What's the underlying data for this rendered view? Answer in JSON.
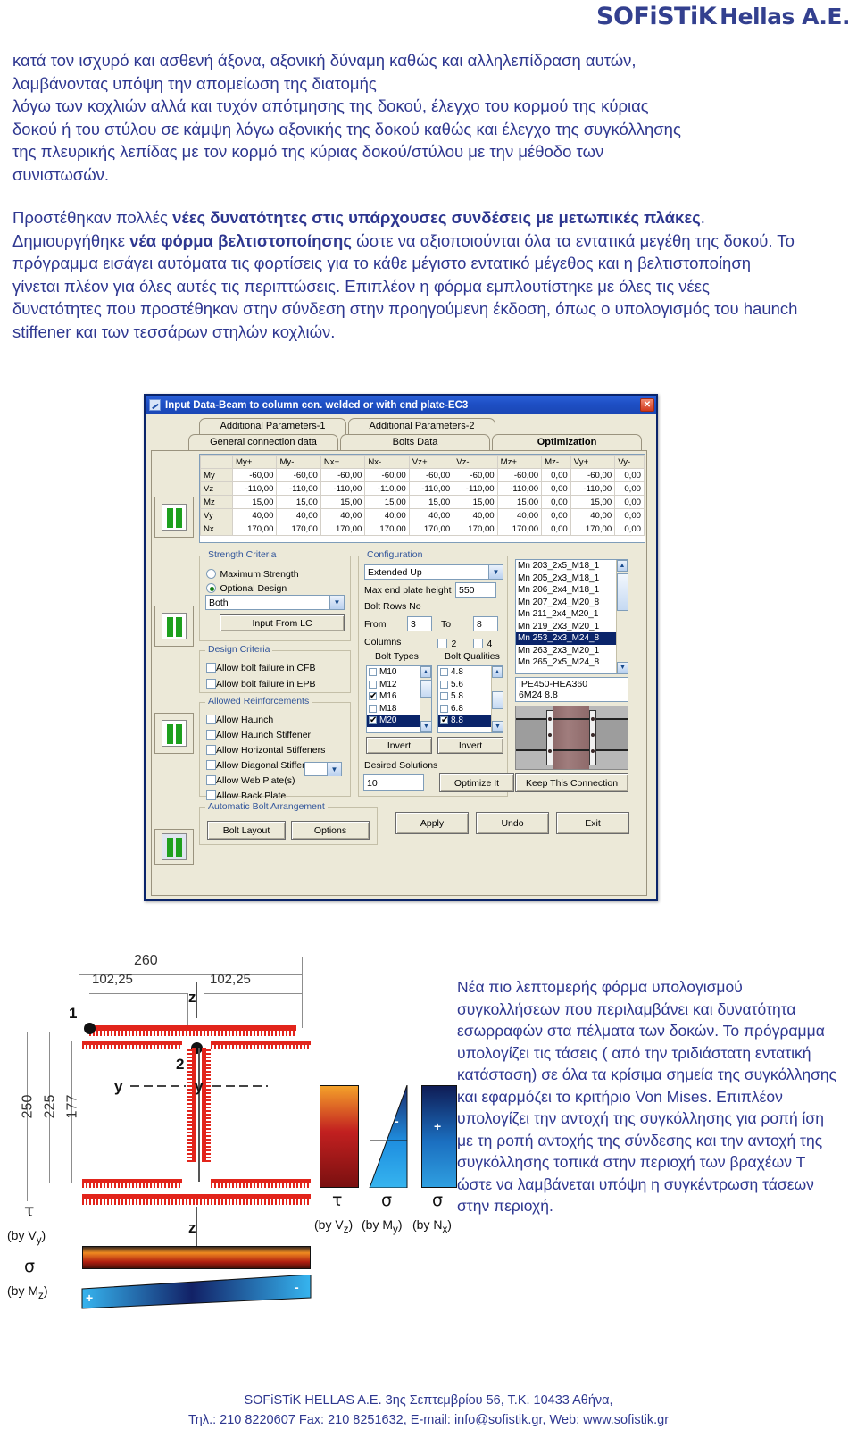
{
  "header": {
    "logo_main": "SOFiSTiK",
    "logo_sub": "Hellas A.E."
  },
  "paragraphs": {
    "p1_line1": "κατά τον ισχυρό και ασθενή άξονα, αξονική δύναμη καθώς και αλληλεπίδραση αυτών,",
    "p1_line2": "λαμβάνοντας υπόψη την απομείωση της διατομής",
    "p1_line3": "λόγω των κοχλιών αλλά και τυχόν απότμησης της δοκού, έλεγχο του κορμού της κύριας",
    "p1_line4": "δοκού ή του στύλου σε κάμψη λόγω αξονικής της δοκού καθώς και έλεγχο της συγκόλλησης",
    "p1_line5": "της πλευρικής λεπίδας με τον κορμό της κύριας δοκού/στύλου με την μέθοδο των",
    "p1_line6": "συνιστωσών.",
    "p2_a": "Προστέθηκαν πολλές ",
    "p2_b1": "νέες δυνατότητες στις υπάρχουσες συνδέσεις με μετωπικές πλάκες",
    "p2_c": ". Δημιουργήθηκε ",
    "p2_b2": "νέα φόρμα βελτιστοποίησης",
    "p2_d": " ώστε να αξιοποιούνται όλα τα εντατικά μεγέθη της δοκού. Το πρόγραμμα εισάγει αυτόματα τις φορτίσεις για το κάθε μέγιστο εντατικό μέγεθος και η βελτιστοποίηση γίνεται πλέον για όλες αυτές τις περιπτώσεις. Επιπλέον η φόρμα εμπλουτίστηκε με όλες τις νέες δυνατότητες που προστέθηκαν στην σύνδεση στην προηγούμενη έκδοση, όπως ο υπολογισμός του haunch stiffener και των τεσσάρων στηλών κοχλιών."
  },
  "dialog": {
    "title": "Input Data-Beam to column con. welded or with end plate-EC3",
    "close_label": "✕",
    "tabs_row1": [
      "Additional Parameters-1",
      "Additional Parameters-2"
    ],
    "tabs_row2": [
      "General connection data",
      "Bolts Data",
      "Optimization"
    ],
    "selected_tab": "Optimization",
    "grid": {
      "columns": [
        "My+",
        "My-",
        "Nx+",
        "Nx-",
        "Vz+",
        "Vz-",
        "Mz+",
        "Mz-",
        "Vy+",
        "Vy-"
      ],
      "rows": [
        {
          "label": "My",
          "values": [
            "-60,00",
            "-60,00",
            "-60,00",
            "-60,00",
            "-60,00",
            "-60,00",
            "-60,00",
            "0,00",
            "-60,00",
            "0,00"
          ]
        },
        {
          "label": "Vz",
          "values": [
            "-110,00",
            "-110,00",
            "-110,00",
            "-110,00",
            "-110,00",
            "-110,00",
            "-110,00",
            "0,00",
            "-110,00",
            "0,00"
          ]
        },
        {
          "label": "Mz",
          "values": [
            "15,00",
            "15,00",
            "15,00",
            "15,00",
            "15,00",
            "15,00",
            "15,00",
            "0,00",
            "15,00",
            "0,00"
          ]
        },
        {
          "label": "Vy",
          "values": [
            "40,00",
            "40,00",
            "40,00",
            "40,00",
            "40,00",
            "40,00",
            "40,00",
            "0,00",
            "40,00",
            "0,00"
          ]
        },
        {
          "label": "Nx",
          "values": [
            "170,00",
            "170,00",
            "170,00",
            "170,00",
            "170,00",
            "170,00",
            "170,00",
            "0,00",
            "170,00",
            "0,00"
          ]
        }
      ]
    },
    "strength_criteria": {
      "legend": "Strength Criteria",
      "radio_max": "Maximum Strength",
      "radio_opt": "Optional Design",
      "radio_selected": "Optional Design",
      "combo_value": "Both",
      "button": "Input From LC"
    },
    "design_criteria": {
      "legend": "Design Criteria",
      "items": [
        {
          "label": "Allow bolt failure in CFB",
          "checked": false
        },
        {
          "label": "Allow bolt failure in EPB",
          "checked": false
        }
      ]
    },
    "allowed_reinforcements": {
      "legend": "Allowed Reinforcements",
      "items": [
        {
          "label": "Allow Haunch",
          "checked": false
        },
        {
          "label": "Allow Haunch Stiffener",
          "checked": false
        },
        {
          "label": "Allow Horizontal Stiffeners",
          "checked": false
        },
        {
          "label": "Allow Diagonal Stiffener",
          "checked": false
        },
        {
          "label": "Allow Web Plate(s)",
          "checked": false
        },
        {
          "label": "Allow Back Plate",
          "checked": false
        }
      ],
      "web_plate_combo_value": ""
    },
    "automatic_bolt_arrangement": {
      "legend": "Automatic Bolt Arrangement",
      "buttons": [
        "Bolt Layout",
        "Options"
      ]
    },
    "configuration": {
      "legend": "Configuration",
      "combo_value": "Extended Up",
      "max_end_plate_height_label": "Max end plate height",
      "max_end_plate_height_value": "550",
      "bolt_rows_label": "Bolt Rows No",
      "from_label": "From",
      "from_value": "3",
      "to_label": "To",
      "to_value": "8",
      "columns_label": "Columns",
      "columns_options": [
        {
          "label": "2",
          "checked": false
        },
        {
          "label": "4",
          "checked": false
        }
      ],
      "bolt_types_label": "Bolt Types",
      "bolt_types": [
        {
          "label": "M10",
          "checked": false,
          "selected": false
        },
        {
          "label": "M12",
          "checked": false,
          "selected": false
        },
        {
          "label": "M16",
          "checked": true,
          "selected": false
        },
        {
          "label": "M18",
          "checked": false,
          "selected": false
        },
        {
          "label": "M20",
          "checked": true,
          "selected": true
        }
      ],
      "bolt_qualities_label": "Bolt Qualities",
      "bolt_qualities": [
        {
          "label": "4.8",
          "checked": false,
          "selected": false
        },
        {
          "label": "5.6",
          "checked": false,
          "selected": false
        },
        {
          "label": "5.8",
          "checked": false,
          "selected": false
        },
        {
          "label": "6.8",
          "checked": false,
          "selected": false
        },
        {
          "label": "8.8",
          "checked": true,
          "selected": true
        }
      ],
      "invert_left": "Invert",
      "invert_right": "Invert"
    },
    "desired_solutions": {
      "label": "Desired Solutions",
      "value": "10",
      "optimize_button": "Optimize It"
    },
    "solutions_list": {
      "items": [
        {
          "text": "Mn  203_2x5_M18_1",
          "selected": false
        },
        {
          "text": "Mn  205_2x3_M18_1",
          "selected": false
        },
        {
          "text": "Mn  206_2x4_M18_1",
          "selected": false
        },
        {
          "text": "Mn  207_2x4_M20_8",
          "selected": false
        },
        {
          "text": "Mn  211_2x4_M20_1",
          "selected": false
        },
        {
          "text": "Mn  219_2x3_M20_1",
          "selected": false
        },
        {
          "text": "Mn  253_2x3_M24_8",
          "selected": true
        },
        {
          "text": "Mn  263_2x3_M20_1",
          "selected": false
        },
        {
          "text": "Mn  265_2x5_M24_8",
          "selected": false
        }
      ]
    },
    "section_info": {
      "line1": "IPE450-HEA360",
      "line2": "6M24 8.8"
    },
    "keep_button": "Keep This Connection",
    "action_buttons": [
      "Apply",
      "Undo",
      "Exit"
    ]
  },
  "drawing": {
    "dim_260": "260",
    "dim_102_left": "102,25",
    "dim_102_right": "102,25",
    "dim_250": "250",
    "dim_225": "225",
    "dim_177": "177",
    "node1": "1",
    "node2": "2",
    "axis_z_top": "z",
    "axis_z_bottom": "z",
    "axis_y_left": "y",
    "axis_y_right": "y",
    "stresses": [
      {
        "symbol": "τ",
        "caption": "(by V",
        "sub": "z",
        "close": ")"
      },
      {
        "symbol": "σ",
        "caption": "(by M",
        "sub": "y",
        "close": ")"
      },
      {
        "symbol": "σ",
        "caption": "(by N",
        "sub": "x",
        "close": ")"
      },
      {
        "symbol": "τ",
        "caption": "(by V",
        "sub": "y",
        "close": ")"
      },
      {
        "symbol": "σ",
        "caption": "(by M",
        "sub": "z",
        "close": ")"
      }
    ],
    "sign_plus": "+",
    "sign_minus": "-"
  },
  "right_text": "Νέα πιο λεπτομερής φόρμα υπολογισμού συγκολλήσεων που περιλαμβάνει και δυνατότητα εσωρραφών στα πέλματα των δοκών. Το πρόγραμμα υπολογίζει τις τάσεις ( από την τριδιάστατη εντατική κατάσταση) σε όλα τα κρίσιμα σημεία της συγκόλλησης και εφαρμόζει το κριτήριο Von Mises. Επιπλέον υπολογίζει την αντοχή της συγκόλλησης για ροπή ίση με τη ροπή αντοχής της σύνδεσης και την αντοχή της συγκόλλησης τοπικά στην περιοχή των βραχέων Τ ώστε να λαμβάνεται υπόψη η συγκέντρωση τάσεων στην περιοχή.",
  "footer": {
    "line1": "SOFiSTiK HELLAS A.E. 3ης Σεπτεμβρίου 56, Τ.Κ. 10433 Αθήνα,",
    "line2": "Τηλ.: 210 8220607 Fax: 210 8251632, E-mail: info@sofistik.gr, Web: www.sofistik.gr"
  }
}
